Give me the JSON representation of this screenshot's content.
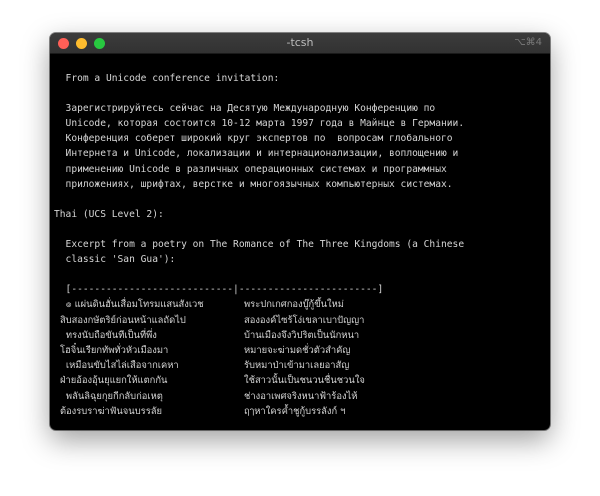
{
  "window": {
    "title": "-tcsh",
    "shortcut": "⌥⌘4"
  },
  "terminal": {
    "lines": [
      "  From a Unicode conference invitation:",
      "",
      "  Зарегистрируйтесь сейчас на Десятую Международную Конференцию по",
      "  Unicode, которая состоится 10-12 марта 1997 года в Майнце в Германии.",
      "  Конференция соберет широкий круг экспертов по  вопросам глобального",
      "  Интернета и Unicode, локализации и интернационализации, воплощению и",
      "  применению Unicode в различных операционных системах и программных",
      "  приложениях, шрифтах, верстке и многоязычных компьютерных системах.",
      "",
      "Thai (UCS Level 2):",
      "",
      "  Excerpt from a poetry on The Romance of The Three Kingdoms (a Chinese",
      "  classic 'San Gua'):",
      "",
      "  [----------------------------|------------------------]"
    ],
    "poem": [
      {
        "left": "    ๏ แผ่นดินฮั่นเสื่อมโทรมแสนสังเวช",
        "right": "พระปกเกศกองบู๊กู้ขึ้นใหม่"
      },
      {
        "left": "  สิบสองกษัตริย์ก่อนหน้าแลถัดไป",
        "right": "สององค์ไซร้โง่เขลาเบาปัญญา"
      },
      {
        "left": "    ทรงนับถือขันทีเป็นที่พึ่ง",
        "right": "บ้านเมืองจึงวิปริตเป็นนักหนา"
      },
      {
        "left": "  โฮจิ๋นเรียกทัพทั่วหัวเมืองมา",
        "right": "หมายจะฆ่ามดชั่วตัวสำคัญ"
      },
      {
        "left": "    เหมือนขับไสไล่เสือจากเคหา",
        "right": "รับหมาป่าเข้ามาเลยอาสัญ"
      },
      {
        "left": "  ฝ่ายอ้องอุ้นยุแยกให้แตกกัน",
        "right": "ใช้สาวนั้นเป็นชนวนชื่นชวนใจ"
      },
      {
        "left": "    พลันลิฉุยกุยกีกลับก่อเหตุ",
        "right": "ช่างอาเพศจริงหนาฟ้าร้องไห้"
      },
      {
        "left": "  ต้องรบราฆ่าฟันจนบรรลัย",
        "right": "ฤๅหาใครค้ำชูกู้บรรลังก์ ฯ"
      }
    ]
  }
}
